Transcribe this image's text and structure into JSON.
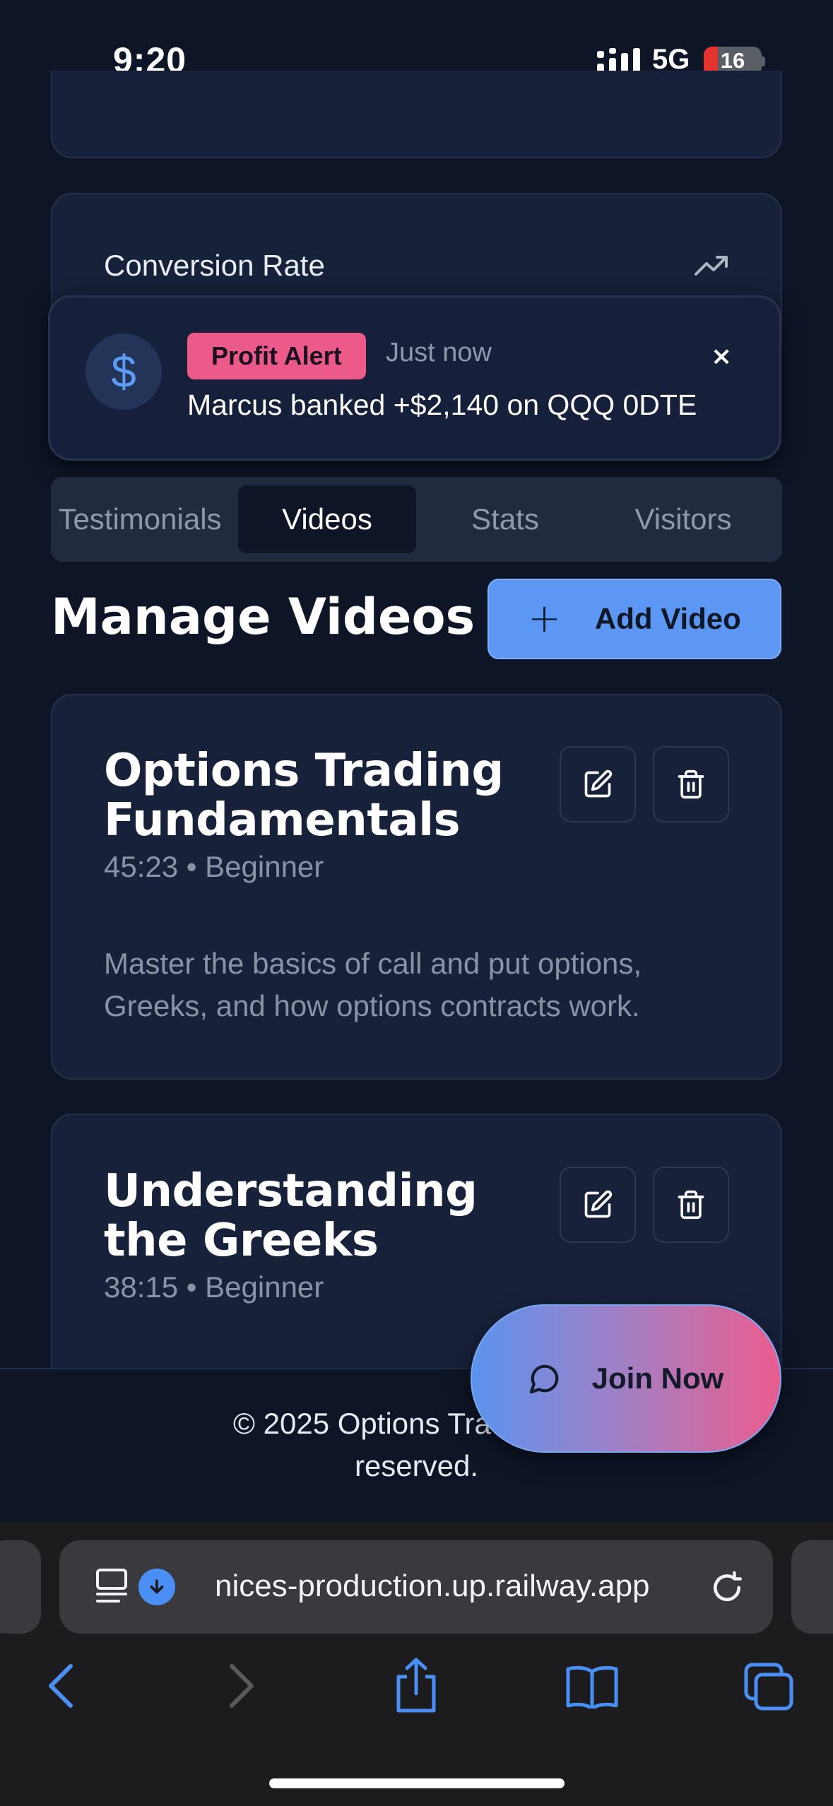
{
  "status": {
    "time": "9:20",
    "network": "5G",
    "battery": "16"
  },
  "conversion": {
    "label": "Conversion Rate"
  },
  "toast": {
    "badge": "Profit Alert",
    "time": "Just now",
    "close": "×",
    "message": "Marcus banked +$2,140 on QQQ 0DTE",
    "icon": "$"
  },
  "tabs": [
    "Testimonials",
    "Videos",
    "Stats",
    "Visitors"
  ],
  "active_tab": "Videos",
  "main": {
    "heading": "Manage Videos",
    "add_label": "Add Video",
    "add_icon": "+"
  },
  "videos": [
    {
      "title_line1": "Options Trading",
      "title_line2": "Fundamentals",
      "meta": "45:23 • Beginner",
      "desc_line1": "Master the basics of call and put options,",
      "desc_line2": "Greeks, and how options contracts work."
    },
    {
      "title_line1": "Understanding",
      "title_line2": "the Greeks",
      "meta": "38:15 • Beginner"
    }
  ],
  "footer": {
    "line1": "© 2025 Options Trading Uni",
    "line2": "reserved."
  },
  "join": {
    "label": "Join Now"
  },
  "browser": {
    "url": "nices-production.up.railway.app"
  }
}
